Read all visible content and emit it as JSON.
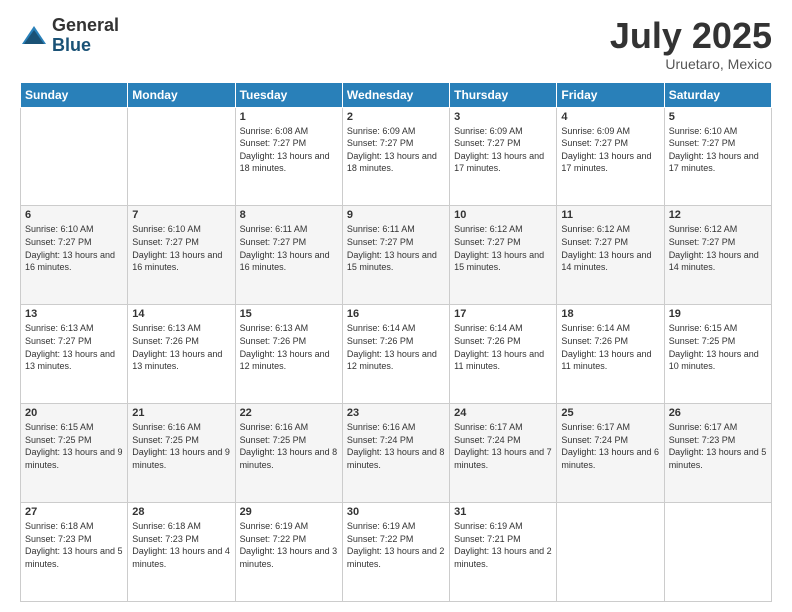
{
  "logo": {
    "general": "General",
    "blue": "Blue"
  },
  "header": {
    "month": "July 2025",
    "location": "Uruetaro, Mexico"
  },
  "weekdays": [
    "Sunday",
    "Monday",
    "Tuesday",
    "Wednesday",
    "Thursday",
    "Friday",
    "Saturday"
  ],
  "weeks": [
    [
      {
        "day": "",
        "info": ""
      },
      {
        "day": "",
        "info": ""
      },
      {
        "day": "1",
        "info": "Sunrise: 6:08 AM\nSunset: 7:27 PM\nDaylight: 13 hours and 18 minutes."
      },
      {
        "day": "2",
        "info": "Sunrise: 6:09 AM\nSunset: 7:27 PM\nDaylight: 13 hours and 18 minutes."
      },
      {
        "day": "3",
        "info": "Sunrise: 6:09 AM\nSunset: 7:27 PM\nDaylight: 13 hours and 17 minutes."
      },
      {
        "day": "4",
        "info": "Sunrise: 6:09 AM\nSunset: 7:27 PM\nDaylight: 13 hours and 17 minutes."
      },
      {
        "day": "5",
        "info": "Sunrise: 6:10 AM\nSunset: 7:27 PM\nDaylight: 13 hours and 17 minutes."
      }
    ],
    [
      {
        "day": "6",
        "info": "Sunrise: 6:10 AM\nSunset: 7:27 PM\nDaylight: 13 hours and 16 minutes."
      },
      {
        "day": "7",
        "info": "Sunrise: 6:10 AM\nSunset: 7:27 PM\nDaylight: 13 hours and 16 minutes."
      },
      {
        "day": "8",
        "info": "Sunrise: 6:11 AM\nSunset: 7:27 PM\nDaylight: 13 hours and 16 minutes."
      },
      {
        "day": "9",
        "info": "Sunrise: 6:11 AM\nSunset: 7:27 PM\nDaylight: 13 hours and 15 minutes."
      },
      {
        "day": "10",
        "info": "Sunrise: 6:12 AM\nSunset: 7:27 PM\nDaylight: 13 hours and 15 minutes."
      },
      {
        "day": "11",
        "info": "Sunrise: 6:12 AM\nSunset: 7:27 PM\nDaylight: 13 hours and 14 minutes."
      },
      {
        "day": "12",
        "info": "Sunrise: 6:12 AM\nSunset: 7:27 PM\nDaylight: 13 hours and 14 minutes."
      }
    ],
    [
      {
        "day": "13",
        "info": "Sunrise: 6:13 AM\nSunset: 7:27 PM\nDaylight: 13 hours and 13 minutes."
      },
      {
        "day": "14",
        "info": "Sunrise: 6:13 AM\nSunset: 7:26 PM\nDaylight: 13 hours and 13 minutes."
      },
      {
        "day": "15",
        "info": "Sunrise: 6:13 AM\nSunset: 7:26 PM\nDaylight: 13 hours and 12 minutes."
      },
      {
        "day": "16",
        "info": "Sunrise: 6:14 AM\nSunset: 7:26 PM\nDaylight: 13 hours and 12 minutes."
      },
      {
        "day": "17",
        "info": "Sunrise: 6:14 AM\nSunset: 7:26 PM\nDaylight: 13 hours and 11 minutes."
      },
      {
        "day": "18",
        "info": "Sunrise: 6:14 AM\nSunset: 7:26 PM\nDaylight: 13 hours and 11 minutes."
      },
      {
        "day": "19",
        "info": "Sunrise: 6:15 AM\nSunset: 7:25 PM\nDaylight: 13 hours and 10 minutes."
      }
    ],
    [
      {
        "day": "20",
        "info": "Sunrise: 6:15 AM\nSunset: 7:25 PM\nDaylight: 13 hours and 9 minutes."
      },
      {
        "day": "21",
        "info": "Sunrise: 6:16 AM\nSunset: 7:25 PM\nDaylight: 13 hours and 9 minutes."
      },
      {
        "day": "22",
        "info": "Sunrise: 6:16 AM\nSunset: 7:25 PM\nDaylight: 13 hours and 8 minutes."
      },
      {
        "day": "23",
        "info": "Sunrise: 6:16 AM\nSunset: 7:24 PM\nDaylight: 13 hours and 8 minutes."
      },
      {
        "day": "24",
        "info": "Sunrise: 6:17 AM\nSunset: 7:24 PM\nDaylight: 13 hours and 7 minutes."
      },
      {
        "day": "25",
        "info": "Sunrise: 6:17 AM\nSunset: 7:24 PM\nDaylight: 13 hours and 6 minutes."
      },
      {
        "day": "26",
        "info": "Sunrise: 6:17 AM\nSunset: 7:23 PM\nDaylight: 13 hours and 5 minutes."
      }
    ],
    [
      {
        "day": "27",
        "info": "Sunrise: 6:18 AM\nSunset: 7:23 PM\nDaylight: 13 hours and 5 minutes."
      },
      {
        "day": "28",
        "info": "Sunrise: 6:18 AM\nSunset: 7:23 PM\nDaylight: 13 hours and 4 minutes."
      },
      {
        "day": "29",
        "info": "Sunrise: 6:19 AM\nSunset: 7:22 PM\nDaylight: 13 hours and 3 minutes."
      },
      {
        "day": "30",
        "info": "Sunrise: 6:19 AM\nSunset: 7:22 PM\nDaylight: 13 hours and 2 minutes."
      },
      {
        "day": "31",
        "info": "Sunrise: 6:19 AM\nSunset: 7:21 PM\nDaylight: 13 hours and 2 minutes."
      },
      {
        "day": "",
        "info": ""
      },
      {
        "day": "",
        "info": ""
      }
    ]
  ]
}
